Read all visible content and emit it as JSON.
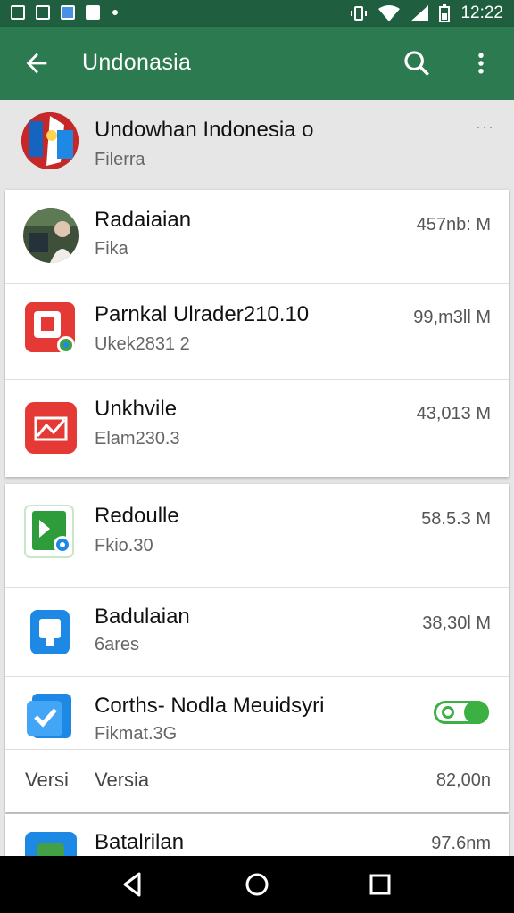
{
  "status_bar": {
    "time": "12:22",
    "left_icons": [
      "photo-icon",
      "gallery-icon",
      "map-icon",
      "calendar-icon",
      "dot-icon"
    ],
    "right_icons": [
      "vibrate-icon",
      "wifi-icon",
      "signal-icon",
      "battery-icon"
    ]
  },
  "app_bar": {
    "title": "Undonasia",
    "back_icon": "arrow-back-icon",
    "search_icon": "search-icon",
    "more_icon": "more-vert-icon"
  },
  "header": {
    "title": "Undowhan Indonesia o",
    "subtitle": "Filerra",
    "more": "···"
  },
  "items": [
    {
      "title": "Radaiaian",
      "subtitle": "Fika",
      "size": "457nb: M",
      "icon": "photo-avatar"
    },
    {
      "title": "Parnkal Ulrader210.10",
      "subtitle": "Ukek2831 2",
      "size": "99,m3ll M",
      "icon": "red-square-app-icon"
    },
    {
      "title": "Unkhvile",
      "subtitle": "Elam230.3",
      "size": "43,013 M",
      "icon": "red-chart-app-icon"
    },
    {
      "title": "Redoulle",
      "subtitle": "Fkio.30",
      "size": "58.5.3 M",
      "icon": "green-doc-app-icon"
    },
    {
      "title": "Badulaian",
      "subtitle": "6ares",
      "size": "38,30l M",
      "icon": "blue-app-icon"
    },
    {
      "title": "Corths- Nodla Meuidsyri",
      "subtitle": "Fikmat.3G",
      "icon": "blue-check-app-icon",
      "toggle_state": "on"
    },
    {
      "title": "Batalrilan",
      "size": "97.6nm",
      "icon": "blue-green-app-icon"
    }
  ],
  "version_row": {
    "label": "Versi",
    "value": "Versia",
    "size": "82,00n"
  },
  "nav_bar": {
    "back": "nav-back-icon",
    "home": "nav-home-icon",
    "recents": "nav-recents-icon"
  }
}
